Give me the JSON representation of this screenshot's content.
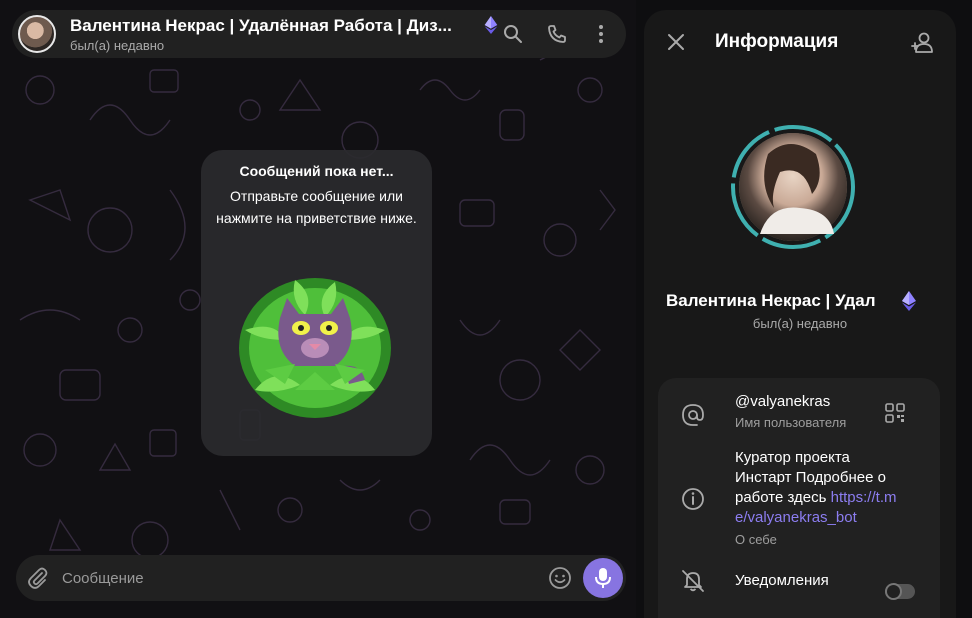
{
  "header": {
    "title": "Валентина Некрас | Удалённая Работа | Диз...",
    "status": "был(а) недавно"
  },
  "empty_state": {
    "title": "Сообщений пока нет...",
    "text": "Отправьте сообщение или нажмите на приветствие ниже."
  },
  "composer": {
    "placeholder": "Сообщение"
  },
  "info_panel": {
    "title": "Информация",
    "name": "Валентина Некрас | Удал",
    "status": "был(а) недавно",
    "username": "@valyanekras",
    "username_label": "Имя пользователя",
    "bio_text": "Куратор проекта Инстарт Подробнее о работе здесь ",
    "bio_link": "https://t.me/valyanekras_bot",
    "bio_label": "О себе",
    "notifications_label": "Уведомления",
    "notifications_on": false
  },
  "icons": {
    "search": "search-icon",
    "call": "phone-icon",
    "more": "more-vertical-icon",
    "premium": "ethereum-gem-icon",
    "attach": "paperclip-icon",
    "emoji": "emoji-icon",
    "mic": "microphone-icon",
    "close": "close-icon",
    "add_contact": "add-contact-icon",
    "username": "at-sign-icon",
    "qr": "qr-code-icon",
    "bio": "info-icon",
    "notifications": "bell-off-icon"
  },
  "colors": {
    "accent": "#8774e1",
    "link": "#8c7df0",
    "panel_bg": "#181818",
    "bar_bg": "#212121"
  }
}
